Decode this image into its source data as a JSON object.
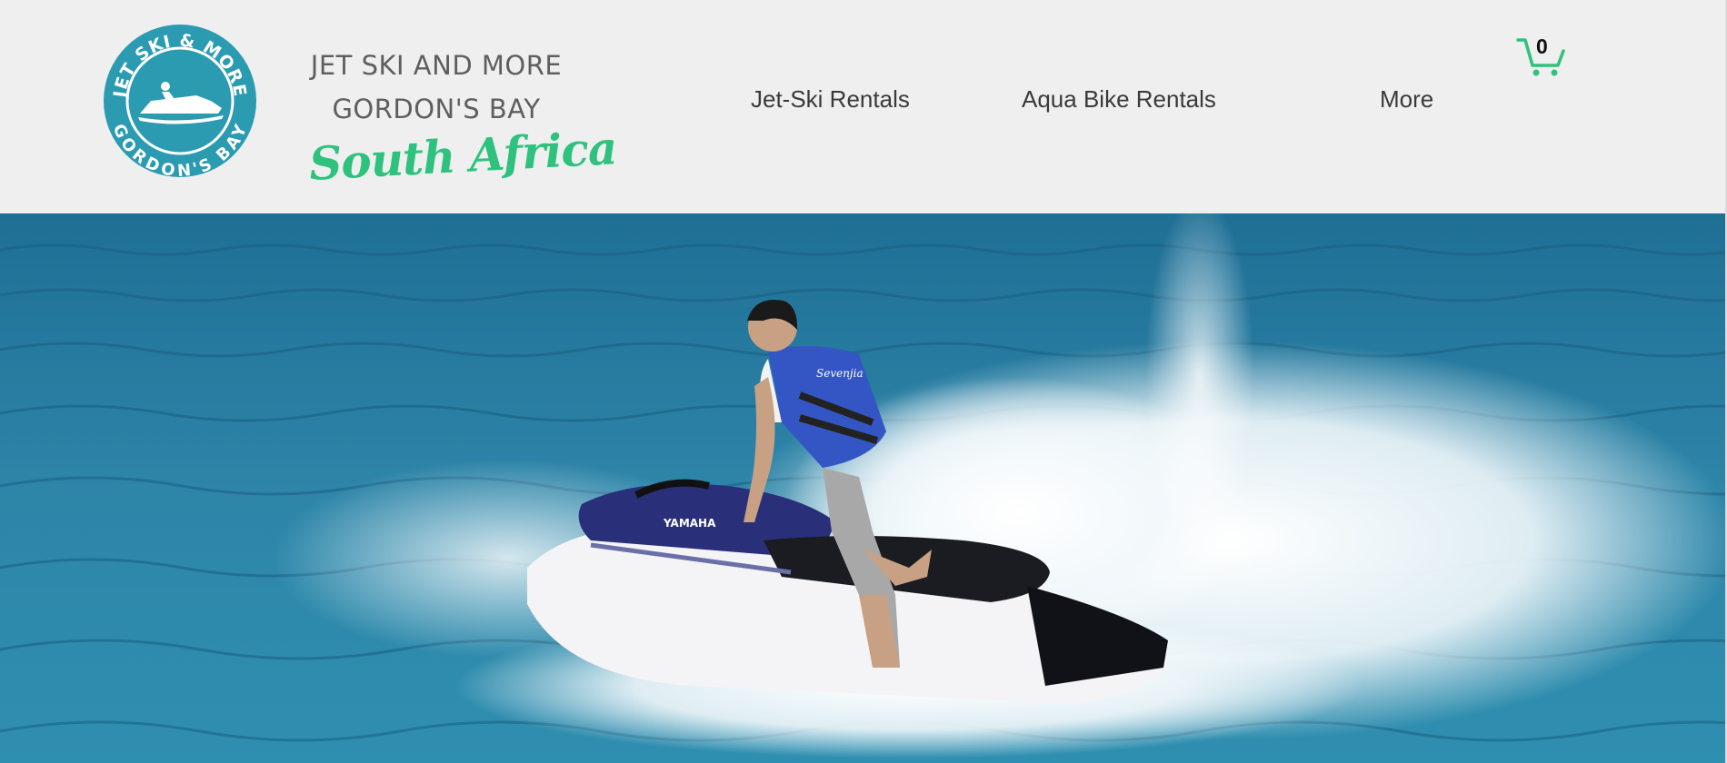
{
  "logo": {
    "top_text": "JET SKI & MORE",
    "bottom_text": "GORDON'S BAY",
    "color": "#2a9bb0"
  },
  "brand": {
    "line1": "JET SKI AND MORE",
    "line2": "GORDON'S BAY",
    "script": "South Africa",
    "script_color": "#2ec27e"
  },
  "nav": {
    "items": [
      {
        "label": "Jet-Ski Rentals"
      },
      {
        "label": "Aqua Bike Rentals"
      },
      {
        "label": "More"
      }
    ]
  },
  "cart": {
    "count": "0",
    "icon": "cart-icon",
    "color": "#2ec27e"
  },
  "hero": {
    "image": "jet-ski-rider-on-ocean",
    "watercraft_brand": "YAMAHA",
    "vest_text": "Sevenjia"
  }
}
